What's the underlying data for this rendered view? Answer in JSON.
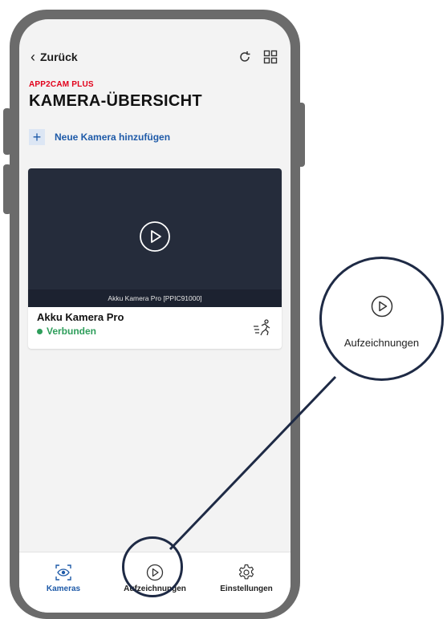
{
  "header": {
    "back_label": "Zurück",
    "brand": "APP2CAM PLUS",
    "title": "KAMERA-ÜBERSICHT"
  },
  "add_camera": {
    "label": "Neue Kamera hinzufügen"
  },
  "camera_card": {
    "caption": "Akku Kamera Pro [PPIC91000]",
    "name": "Akku Kamera Pro",
    "status": "Verbunden"
  },
  "bottom_nav": {
    "items": [
      {
        "label": "Kameras",
        "icon": "camera-eye-icon",
        "active": true
      },
      {
        "label": "Aufzeichnungen",
        "icon": "play-circle-icon",
        "active": false
      },
      {
        "label": "Einstellungen",
        "icon": "gear-icon",
        "active": false
      }
    ]
  },
  "callout": {
    "label": "Aufzeichnungen",
    "icon": "play-circle-icon"
  },
  "colors": {
    "brand": "#e2001a",
    "accent": "#1e5aa8",
    "status": "#2e9e5b",
    "frame": "#6b6b6b",
    "outline": "#1e2a45"
  }
}
